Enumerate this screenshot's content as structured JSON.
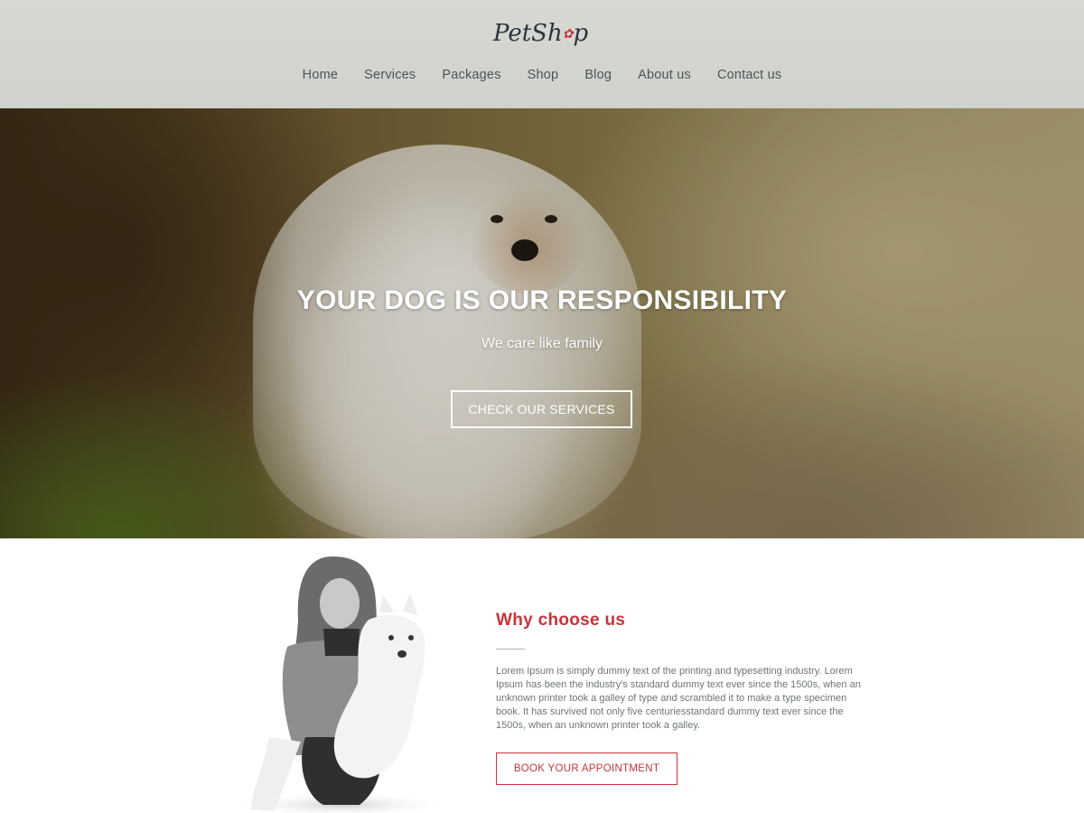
{
  "brand": {
    "logo_text": "PetSh",
    "logo_suffix": "p",
    "accent": "#c7343b"
  },
  "nav": {
    "items": [
      {
        "label": "Home"
      },
      {
        "label": "Services"
      },
      {
        "label": "Packages"
      },
      {
        "label": "Shop"
      },
      {
        "label": "Blog"
      },
      {
        "label": "About us"
      },
      {
        "label": "Contact us"
      }
    ]
  },
  "hero": {
    "title": "YOUR DOG IS OUR RESPONSIBILITY",
    "subtitle": "We care like family",
    "cta_label": "CHECK OUR SERVICES"
  },
  "why": {
    "title": "Why choose us",
    "body": "Lorem Ipsum is simply dummy text of the printing and typesetting industry. Lorem Ipsum has been the industry's standard dummy text ever since the 1500s, when an unknown printer took a galley of type and scrambled it to make a type specimen book. It has survived not only five centuriesstandard dummy text ever since the 1500s, when an unknown printer took a galley.",
    "cta_label": "BOOK YOUR APPOINTMENT"
  }
}
